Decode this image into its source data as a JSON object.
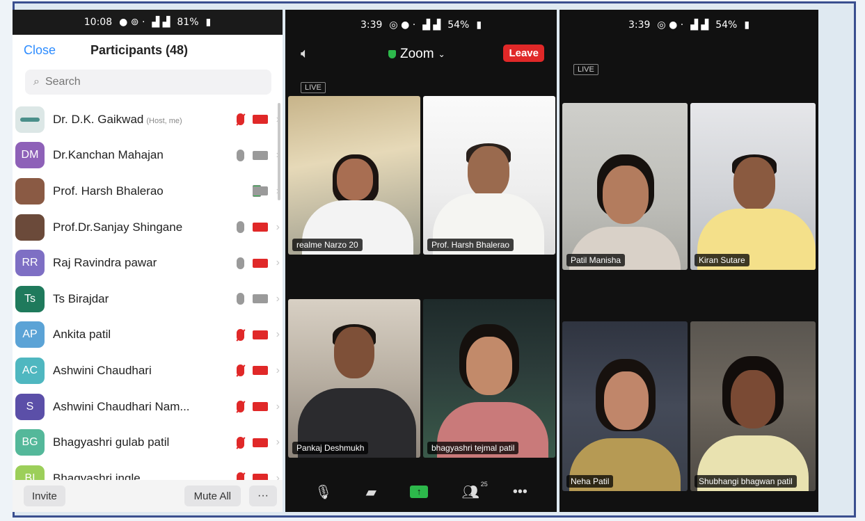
{
  "participants_phone": {
    "status_bar": {
      "time": "10:08",
      "battery": "81%"
    },
    "header": {
      "close_label": "Close",
      "title": "Participants (48)"
    },
    "search": {
      "placeholder": "Search"
    },
    "participants": [
      {
        "name": "Dr. D.K. Gaikwad",
        "tag": "(Host, me)",
        "avatar_text": "",
        "avatar_color": "#dce7e6",
        "mic": "off",
        "cam": "off"
      },
      {
        "name": "Dr.Kanchan Mahajan",
        "tag": "",
        "avatar_text": "DM",
        "avatar_color": "#8e61b8",
        "mic": "on",
        "cam": "on"
      },
      {
        "name": "Prof. Harsh Bhalerao",
        "tag": "",
        "avatar_text": "",
        "avatar_color": "#8a5a44",
        "mic": "live",
        "cam": "on"
      },
      {
        "name": "Prof.Dr.Sanjay Shingane",
        "tag": "",
        "avatar_text": "",
        "avatar_color": "#6b4a3a",
        "mic": "on",
        "cam": "off"
      },
      {
        "name": "Raj Ravindra pawar",
        "tag": "",
        "avatar_text": "RR",
        "avatar_color": "#7e6fc4",
        "mic": "on",
        "cam": "off"
      },
      {
        "name": "Ts Birajdar",
        "tag": "",
        "avatar_text": "Ts",
        "avatar_color": "#1f7a5c",
        "mic": "on",
        "cam": "on"
      },
      {
        "name": "Ankita patil",
        "tag": "",
        "avatar_text": "AP",
        "avatar_color": "#5ba3d6",
        "mic": "off",
        "cam": "off"
      },
      {
        "name": "Ashwini Chaudhari",
        "tag": "",
        "avatar_text": "AC",
        "avatar_color": "#4fb7c0",
        "mic": "off",
        "cam": "off"
      },
      {
        "name": "Ashwini Chaudhari  Nam...",
        "tag": "",
        "avatar_text": "S",
        "avatar_color": "#5b4fa8",
        "mic": "off",
        "cam": "off"
      },
      {
        "name": "Bhagyashri gulab patil",
        "tag": "",
        "avatar_text": "BG",
        "avatar_color": "#54b89a",
        "mic": "off",
        "cam": "off"
      },
      {
        "name": "Bhagyashri ingle",
        "tag": "",
        "avatar_text": "BI",
        "avatar_color": "#9ccf5a",
        "mic": "off",
        "cam": "off"
      }
    ],
    "footer": {
      "invite_label": "Invite",
      "mute_all_label": "Mute All",
      "more_label": "···"
    }
  },
  "meeting_phone_1": {
    "status_bar": {
      "time": "3:39",
      "battery": "54%"
    },
    "title": "Zoom",
    "leave_label": "Leave",
    "live_badge": "LIVE",
    "tiles": [
      {
        "name": "realme Narzo 20"
      },
      {
        "name": "Prof. Harsh Bhalerao"
      },
      {
        "name": "Pankaj Deshmukh"
      },
      {
        "name": "bhagyashri tejmal patil"
      }
    ],
    "participant_count": "25"
  },
  "meeting_phone_2": {
    "status_bar": {
      "time": "3:39",
      "battery": "54%"
    },
    "live_badge": "LIVE",
    "tiles": [
      {
        "name": "Patil Manisha"
      },
      {
        "name": "Kiran Sutare"
      },
      {
        "name": "Neha Patil"
      },
      {
        "name": "Shubhangi bhagwan patil"
      }
    ]
  }
}
